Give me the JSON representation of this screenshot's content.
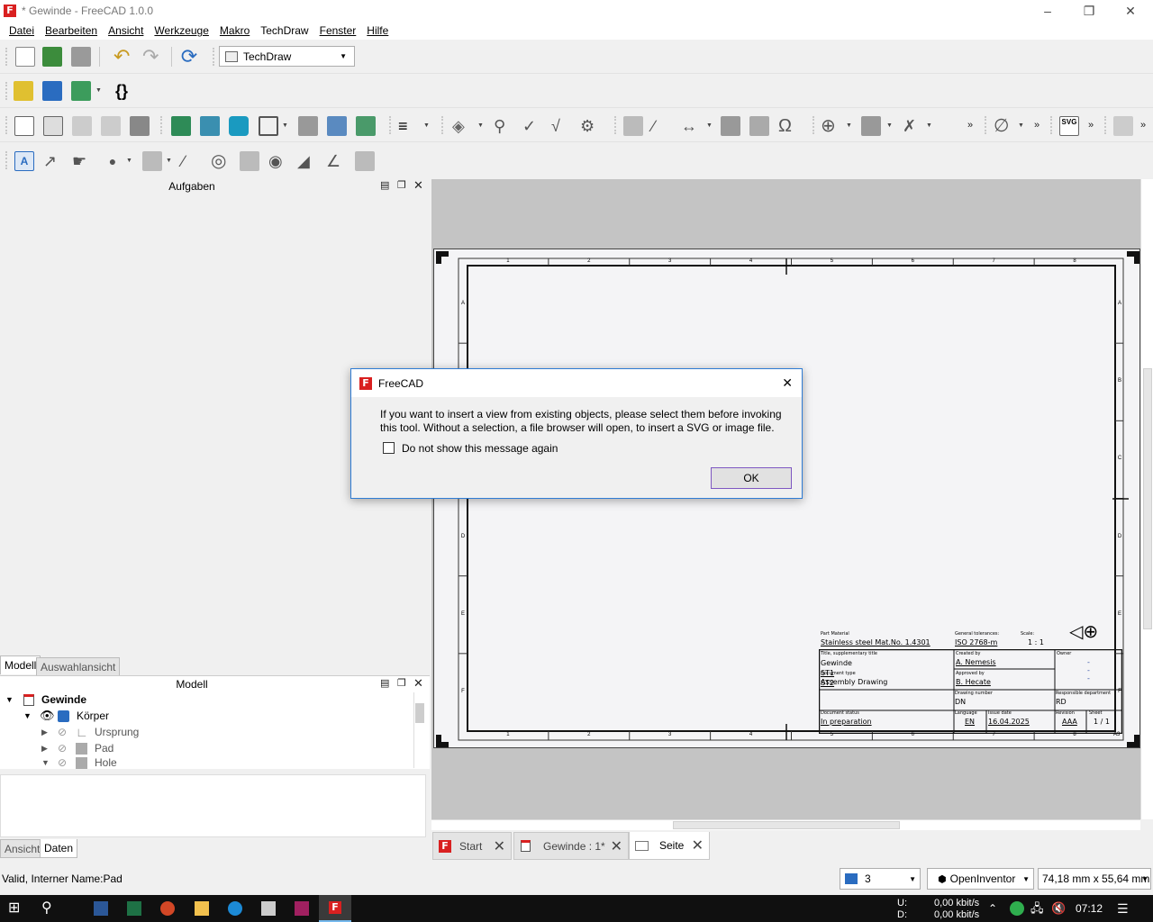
{
  "window": {
    "title": "* Gewinde - FreeCAD 1.0.0",
    "app_letter": "F"
  },
  "menu": [
    "Datei",
    "Bearbeiten",
    "Ansicht",
    "Werkzeuge",
    "Makro",
    "TechDraw",
    "Fenster",
    "Hilfe"
  ],
  "toolbar": {
    "workbench": "TechDraw",
    "overflow": "»",
    "svg_label": "SVG"
  },
  "tasks_panel": {
    "title": "Aufgaben"
  },
  "combo_tabs": [
    "Modell",
    "Auswahlansicht"
  ],
  "model_panel": {
    "title": "Modell",
    "tree": [
      {
        "label": "Gewinde"
      },
      {
        "label": "Körper"
      },
      {
        "label": "Ursprung"
      },
      {
        "label": "Pad"
      },
      {
        "label": "Hole"
      }
    ]
  },
  "property_tabs": [
    "Ansicht",
    "Daten"
  ],
  "drawing": {
    "columns": [
      "1",
      "2",
      "3",
      "4",
      "5",
      "6",
      "7",
      "8"
    ],
    "rows": [
      "A",
      "B",
      "C",
      "D",
      "E",
      "F"
    ],
    "sheet_size": "A3",
    "titleblock": {
      "part_material_label": "Part Material",
      "part_material": "Stainless steel Mat.No. 1.4301",
      "general_tolerances_label": "General tolerances:",
      "general_tolerances": "ISO 2768-m",
      "scale_label": "Scale:",
      "scale": "1 : 1",
      "title_label": "Title, supplementary title",
      "title_lines": [
        "Gewinde",
        "ST1",
        "ST2"
      ],
      "created_by_label": "Created by",
      "created_by": "A. Nemesis",
      "approved_by_label": "Approved by",
      "approved_by": "B. Hecate",
      "owner_label": "Owner",
      "owner_lines": [
        "-",
        "-",
        "-"
      ],
      "document_type_label": "Document type",
      "document_type": "Assembly Drawing",
      "drawing_number_label": "Drawing number",
      "drawing_number": "DN",
      "responsible_label": "Responsible department",
      "responsible": "RD",
      "document_status_label": "Document status",
      "document_status": "In preparation",
      "language_label": "Language",
      "language": "EN",
      "issue_date_label": "Issue date",
      "issue_date": "16.04.2025",
      "revision_label": "Revision",
      "revision": "AAA",
      "sheet_label": "Sheet",
      "sheet": "1 / 1"
    }
  },
  "dialog": {
    "title": "FreeCAD",
    "message": "If you want to insert a view from existing objects, please select them before invoking this tool. Without a selection, a file browser will open, to insert a SVG or image file.",
    "checkbox_label": "Do not show this message again",
    "checked": false,
    "ok_label": "OK"
  },
  "doc_tabs": [
    {
      "label": "Start"
    },
    {
      "label": "Gewinde : 1*"
    },
    {
      "label": "Seite"
    }
  ],
  "status": {
    "message": "Valid, Interner Name:Pad",
    "layer": "3",
    "navigation": "OpenInventor",
    "dimensions": "74,18 mm x 55,64 mm"
  },
  "taskbar": {
    "upload_label": "U:",
    "download_label": "D:",
    "upload": "0,00 kbit/s",
    "download": "0,00 kbit/s",
    "time": "07:12"
  }
}
